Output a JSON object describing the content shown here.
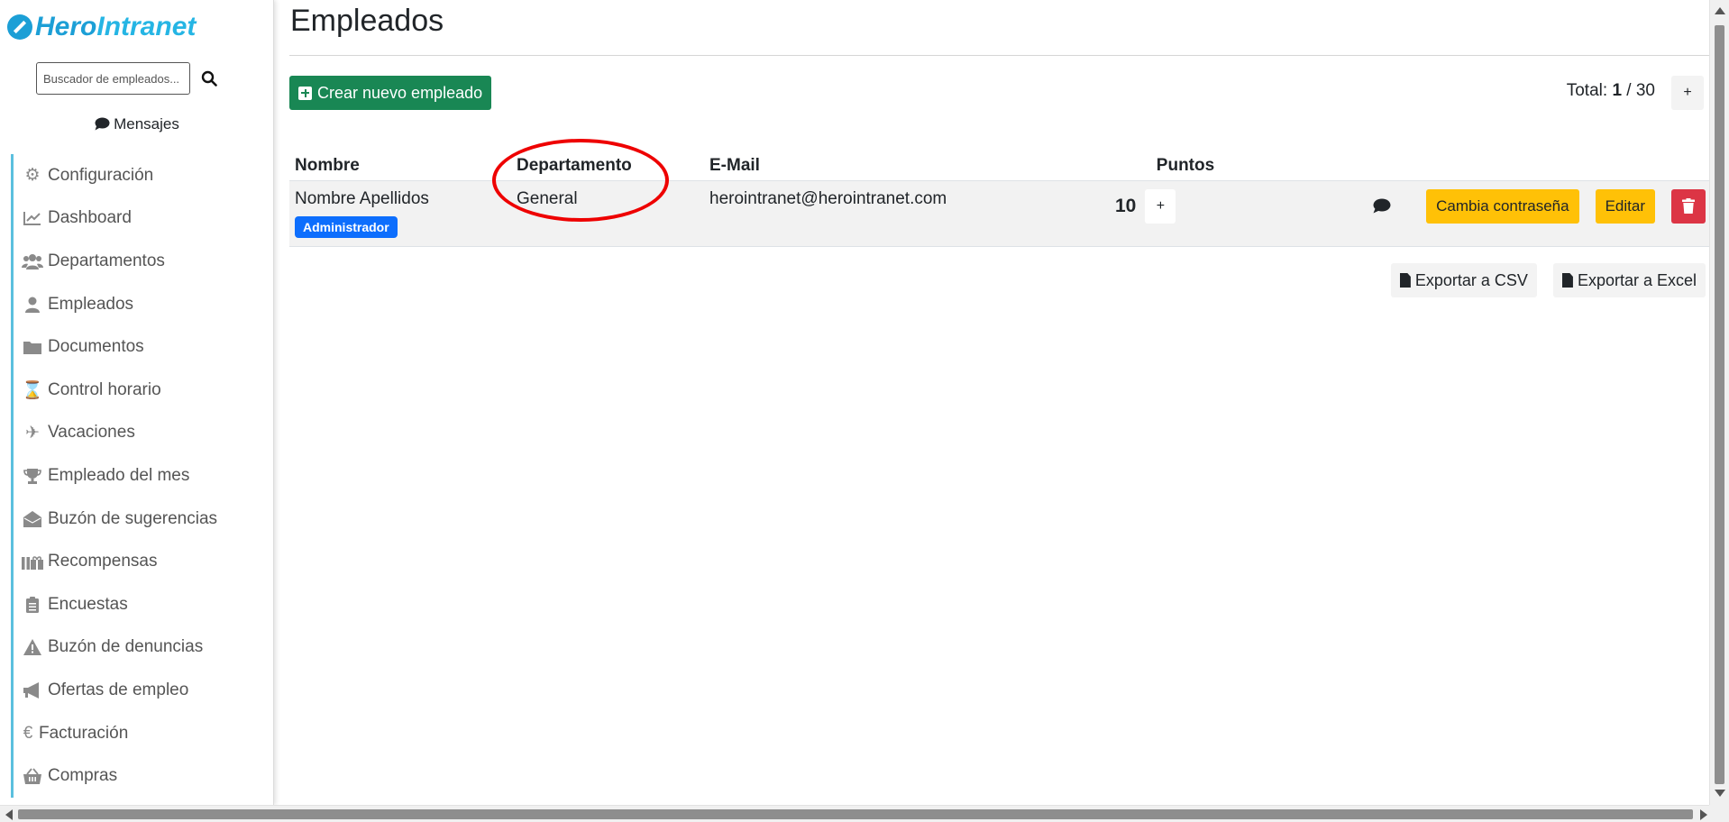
{
  "brand": {
    "part1": "Hero",
    "part2": "Intranet"
  },
  "search": {
    "placeholder": "Buscador de empleados..."
  },
  "messages_label": "Mensajes",
  "nav": [
    {
      "key": "configuracion",
      "label": "Configuración",
      "icon": "gear-icon"
    },
    {
      "key": "dashboard",
      "label": "Dashboard",
      "icon": "chart-line-icon"
    },
    {
      "key": "departamentos",
      "label": "Departamentos",
      "icon": "users-icon"
    },
    {
      "key": "empleados",
      "label": "Empleados",
      "icon": "user-icon"
    },
    {
      "key": "documentos",
      "label": "Documentos",
      "icon": "folder-icon"
    },
    {
      "key": "control-horario",
      "label": "Control horario",
      "icon": "hourglass-icon"
    },
    {
      "key": "vacaciones",
      "label": "Vacaciones",
      "icon": "plane-icon"
    },
    {
      "key": "empleado-del-mes",
      "label": "Empleado del mes",
      "icon": "trophy-icon"
    },
    {
      "key": "buzon-sugerencias",
      "label": "Buzón de sugerencias",
      "icon": "envelope-open-icon"
    },
    {
      "key": "recompensas",
      "label": "Recompensas",
      "icon": "gifts-icon"
    },
    {
      "key": "encuestas",
      "label": "Encuestas",
      "icon": "clipboard-list-icon"
    },
    {
      "key": "buzon-denuncias",
      "label": "Buzón de denuncias",
      "icon": "warning-icon"
    },
    {
      "key": "ofertas-empleo",
      "label": "Ofertas de empleo",
      "icon": "megaphone-icon"
    },
    {
      "key": "facturacion",
      "label": "Facturación",
      "icon": "euro-icon"
    },
    {
      "key": "compras",
      "label": "Compras",
      "icon": "basket-icon"
    }
  ],
  "page": {
    "title": "Empleados",
    "create_label": "Crear nuevo empleado",
    "total_prefix": "Total:",
    "total_current": "1",
    "total_sep": "/",
    "total_max": "30",
    "total_plus": "+"
  },
  "table": {
    "headers": {
      "nombre": "Nombre",
      "departamento": "Departamento",
      "email": "E-Mail",
      "puntos": "Puntos"
    },
    "rows": [
      {
        "nombre": "Nombre Apellidos",
        "badge": "Administrador",
        "departamento": "General",
        "email": "herointranet@herointranet.com",
        "puntos": "10",
        "plus": "+",
        "change_password": "Cambia contraseña",
        "edit": "Editar"
      }
    ]
  },
  "export": {
    "csv": "Exportar a CSV",
    "excel": "Exportar a Excel"
  },
  "colors": {
    "primary": "#0d6efd",
    "success": "#198754",
    "warning": "#ffc107",
    "danger": "#dc3545",
    "brand": "#1c9fd6",
    "nav_border": "#5bc0de",
    "highlight": "#e00000"
  }
}
